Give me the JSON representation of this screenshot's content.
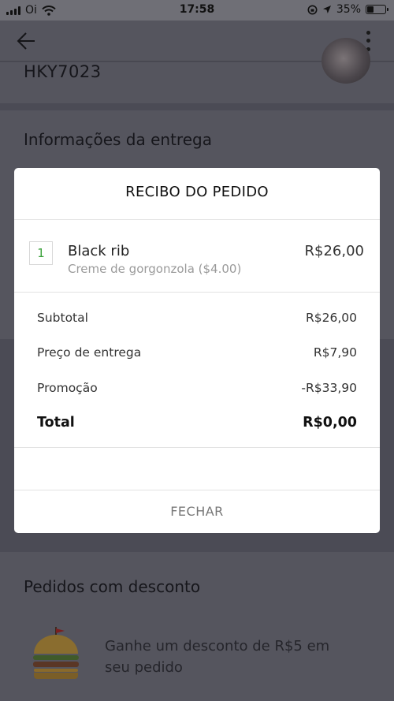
{
  "status_bar": {
    "carrier": "Oi",
    "time": "17:58",
    "battery_percent": "35%",
    "battery_level": 0.35
  },
  "background": {
    "vehicle_plate": "HKY7023",
    "delivery_info_title": "Informações da entrega",
    "discounted_orders_title": "Pedidos com desconto",
    "promo_text": "Ganhe um desconto de R$5 em seu pedido"
  },
  "receipt": {
    "title": "RECIBO DO PEDIDO",
    "items": [
      {
        "quantity": "1",
        "name": "Black rib",
        "modifier": "Creme de gorgonzola ($4.00)",
        "price": "R$26,00"
      }
    ],
    "summary": {
      "subtotal_label": "Subtotal",
      "subtotal_value": "R$26,00",
      "delivery_label": "Preço de entrega",
      "delivery_value": "R$7,90",
      "promo_label": "Promoção",
      "promo_value": "-R$33,90",
      "total_label": "Total",
      "total_value": "R$0,00"
    },
    "close_label": "FECHAR"
  },
  "colors": {
    "overlay": "#4b4b55",
    "modal_bg": "#ffffff",
    "quantity_green": "#3aa13a"
  }
}
